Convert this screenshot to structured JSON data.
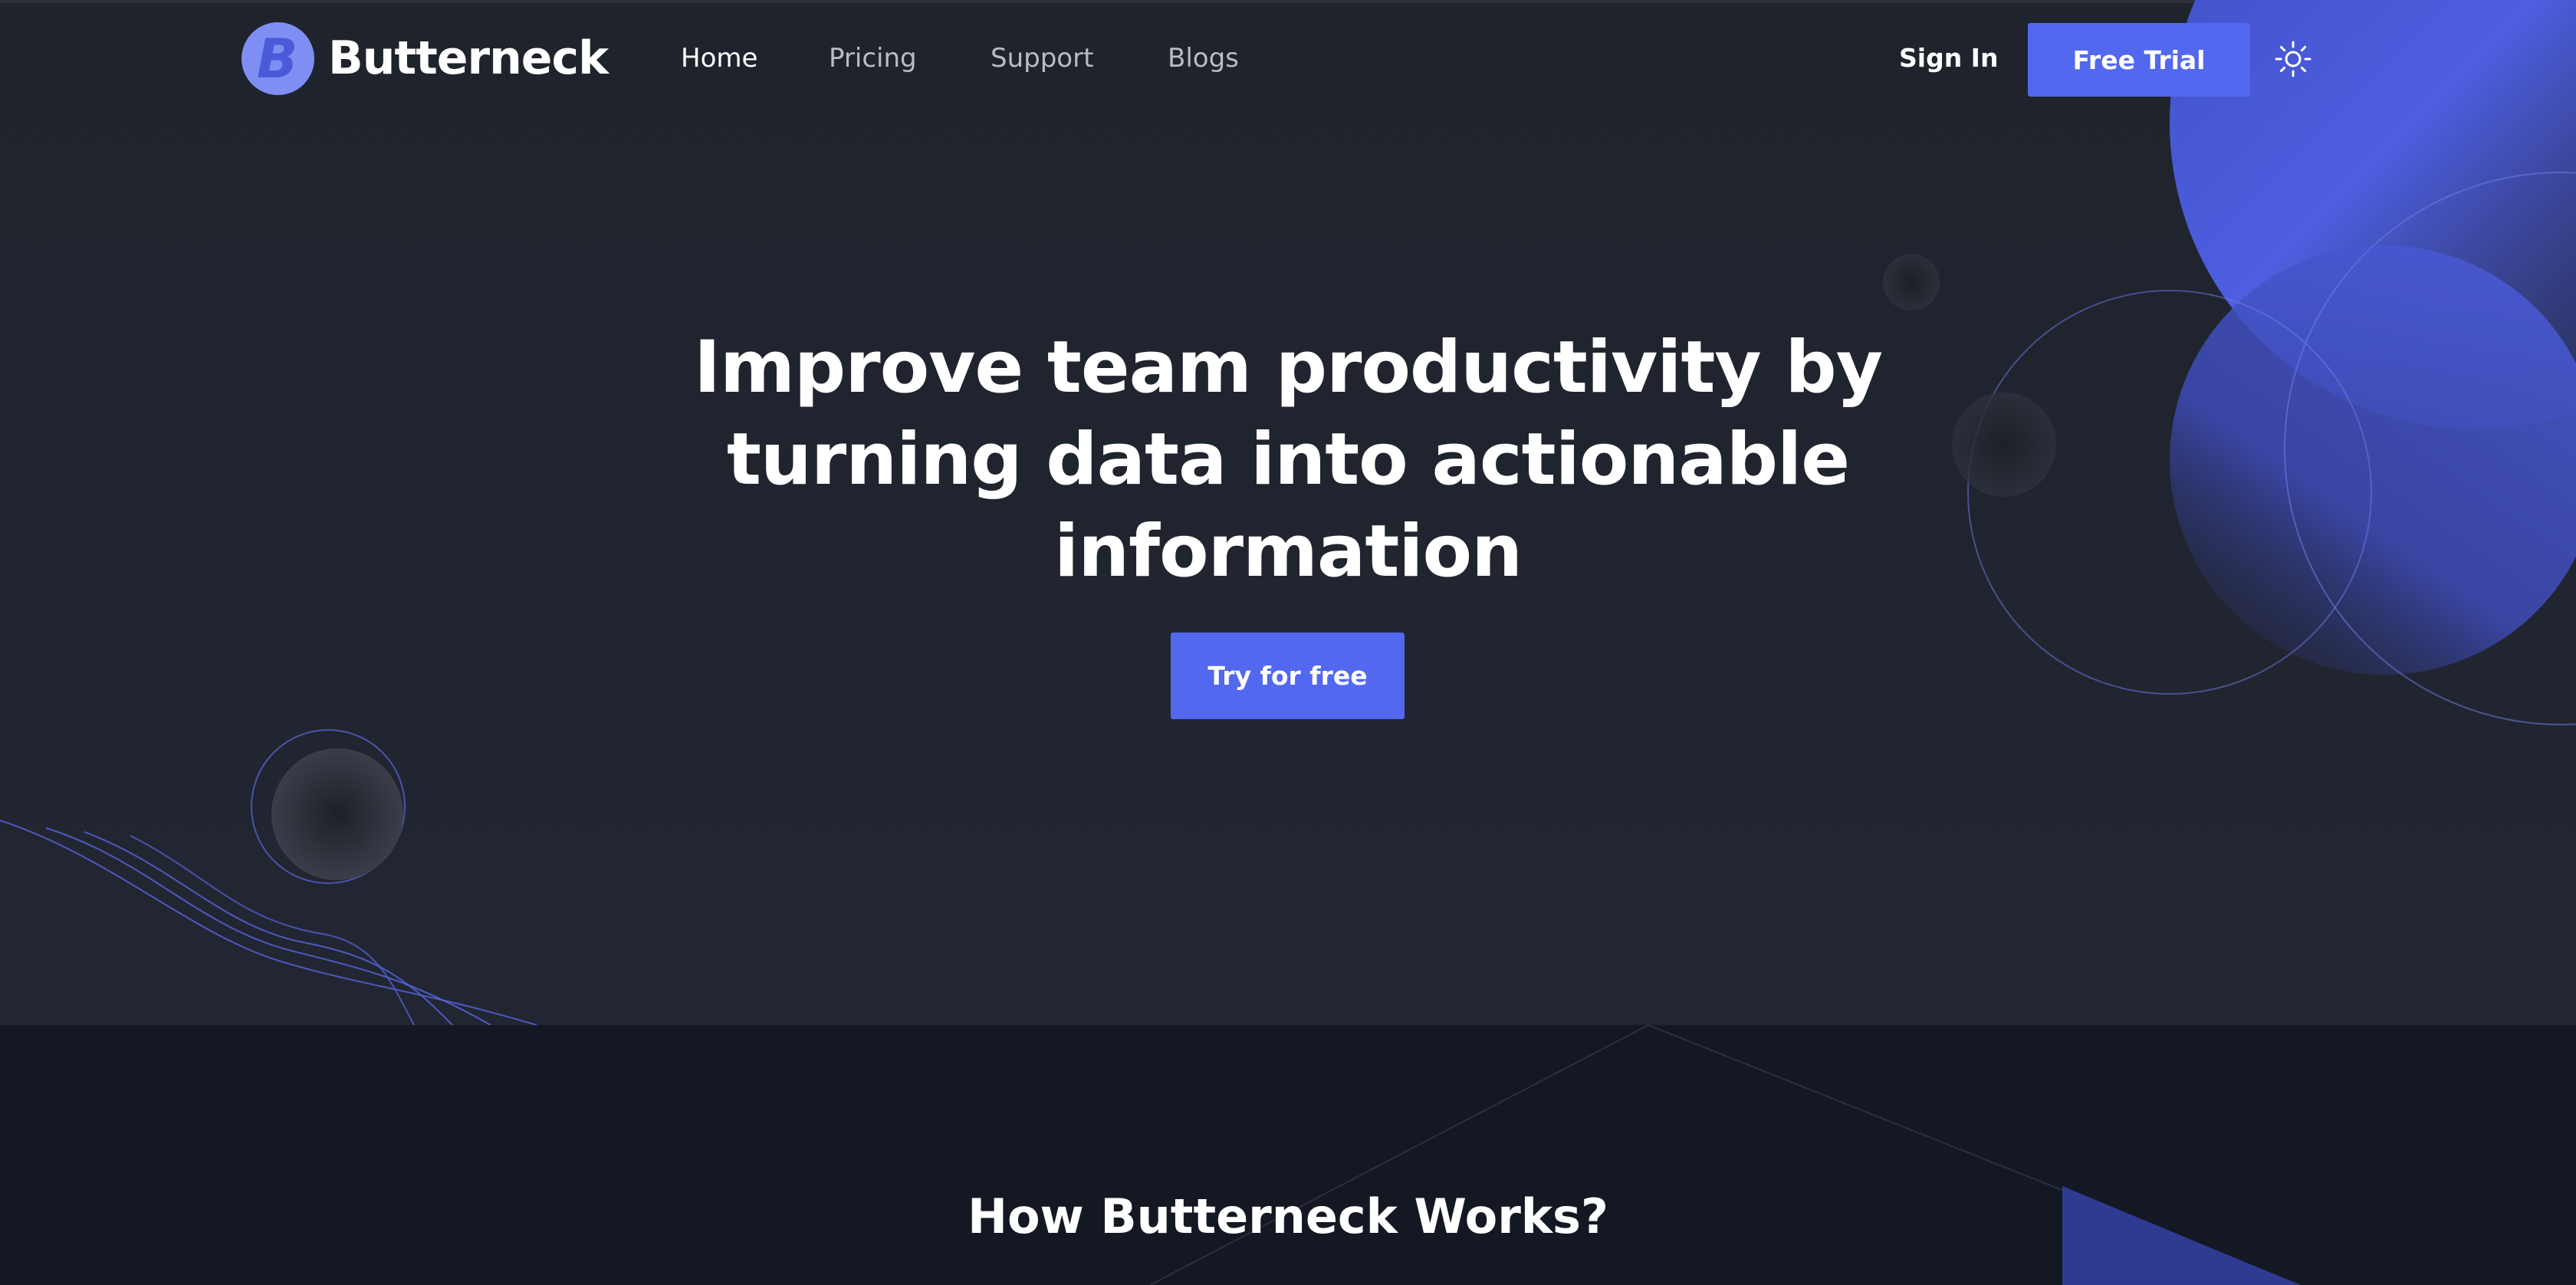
{
  "brand": {
    "logo_letter": "B",
    "name": "Butterneck"
  },
  "nav": {
    "items": [
      {
        "label": "Home",
        "active": true
      },
      {
        "label": "Pricing",
        "active": false
      },
      {
        "label": "Support",
        "active": false
      },
      {
        "label": "Blogs",
        "active": false
      }
    ],
    "sign_in_label": "Sign In",
    "free_trial_label": "Free Trial",
    "theme_icon": "sun-icon"
  },
  "hero": {
    "heading": "Improve team productivity by turning data into actionable information",
    "cta_label": "Try for free"
  },
  "works": {
    "heading": "How Butterneck Works?"
  },
  "colors": {
    "accent": "#5268ee",
    "logo": "#7f8ef2",
    "hero_bg": "#1f232c",
    "section_bg": "#131823",
    "text": "#ffffff",
    "nav_text": "#b7bcc6"
  }
}
